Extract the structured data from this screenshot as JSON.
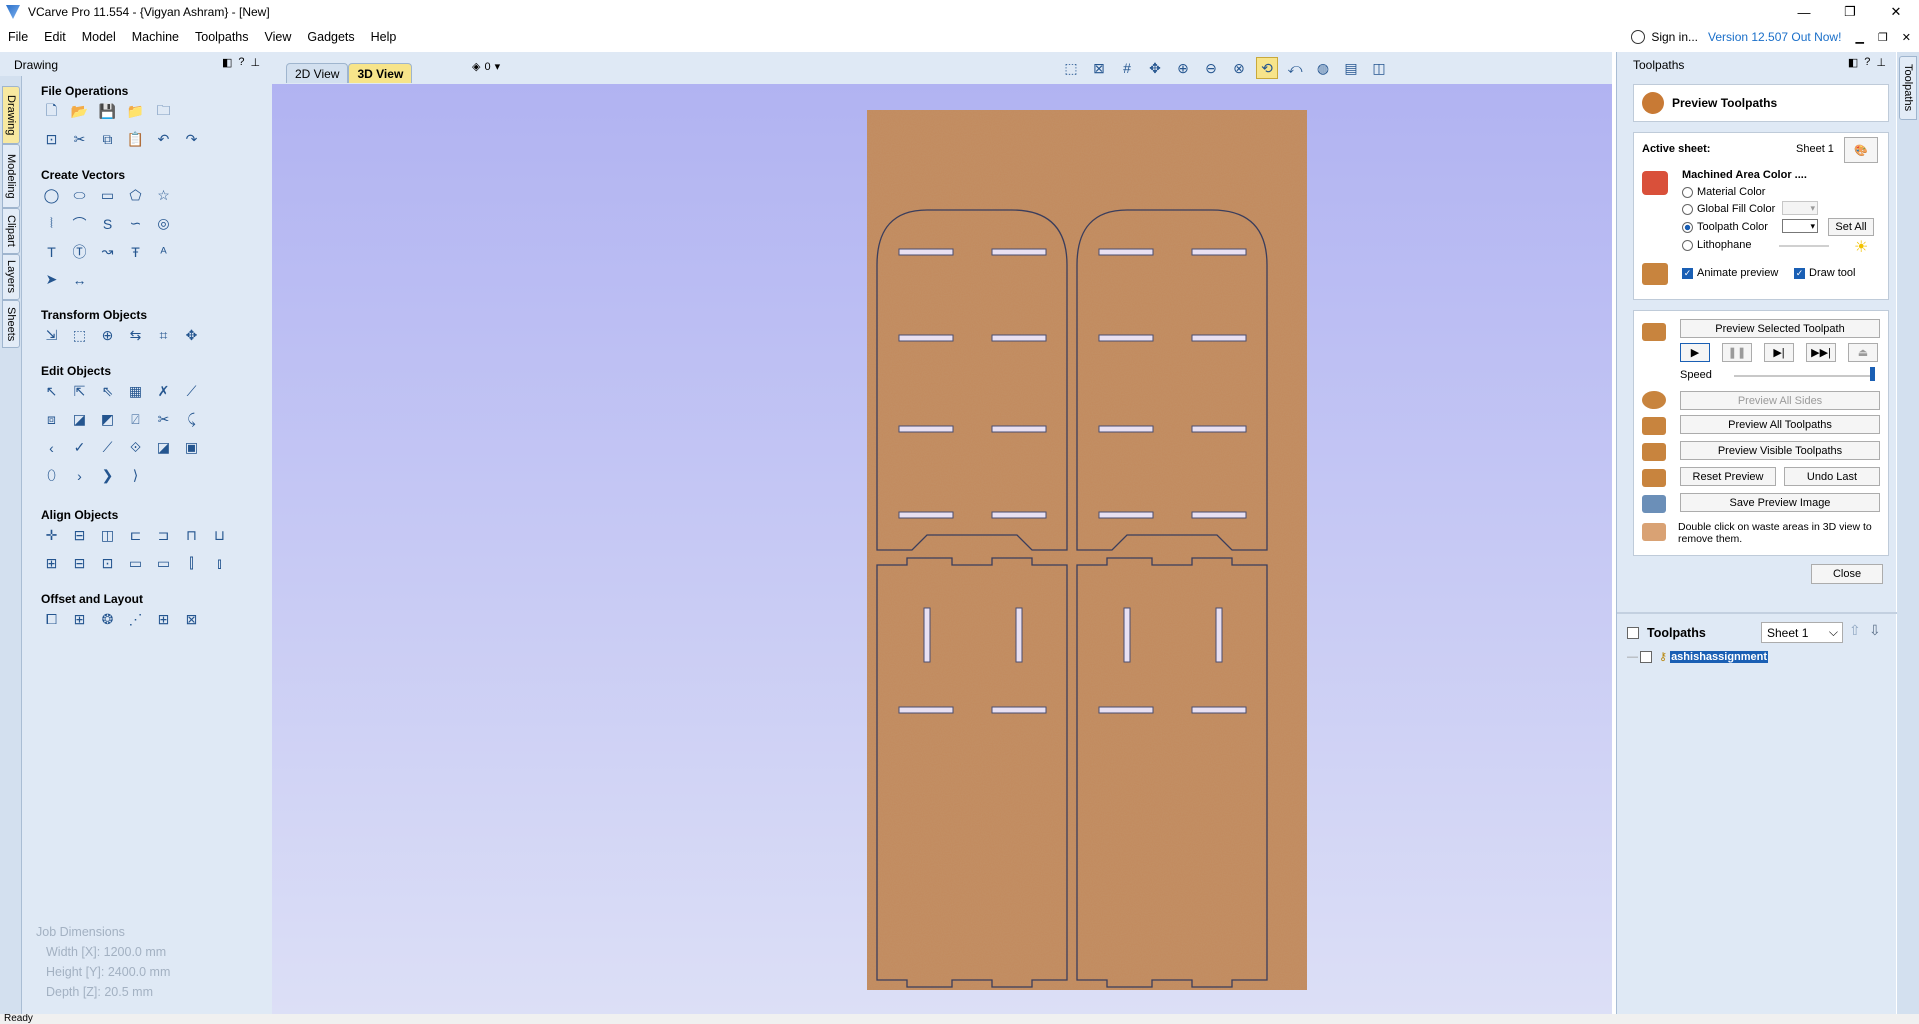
{
  "window": {
    "title": "VCarve Pro 11.554 - {Vigyan Ashram} - [New]",
    "buttons": [
      "—",
      "❐",
      "✕"
    ]
  },
  "menu": {
    "items": [
      "File",
      "Edit",
      "Model",
      "Machine",
      "Toolpaths",
      "View",
      "Gadgets",
      "Help"
    ],
    "sign_in": "Sign in...",
    "version": "Version 12.507 Out Now!"
  },
  "left_panel": {
    "title": "Drawing",
    "vertical_tabs": [
      "Drawing",
      "Modeling",
      "Clipart",
      "Layers",
      "Sheets"
    ],
    "sections": {
      "file_operations": "File Operations",
      "create_vectors": "Create Vectors",
      "transform_objects": "Transform Objects",
      "edit_objects": "Edit Objects",
      "align_objects": "Align Objects",
      "offset_layout": "Offset and Layout"
    },
    "job_dimensions": {
      "title": "Job Dimensions",
      "width": "Width  [X]: 1200.0 mm",
      "height": "Height [Y]: 2400.0 mm",
      "depth": "Depth  [Z]: 20.5 mm"
    }
  },
  "view": {
    "tab_2d": "2D View",
    "tab_3d": "3D View",
    "layer_value": "0"
  },
  "right_panel": {
    "title": "Toolpaths",
    "vertical_tab": "Toolpaths",
    "preview_title": "Preview Toolpaths",
    "active_sheet_label": "Active sheet:",
    "active_sheet_value": "Sheet 1",
    "machined_area_color": "Machined Area Color ....",
    "options": [
      "Material Color",
      "Global Fill Color",
      "Toolpath Color",
      "Lithophane"
    ],
    "set_all": "Set All",
    "animate_preview": "Animate preview",
    "draw_tool": "Draw tool",
    "preview_selected": "Preview Selected Toolpath",
    "speed": "Speed",
    "preview_all_sides": "Preview All Sides",
    "preview_all": "Preview All Toolpaths",
    "preview_visible": "Preview Visible Toolpaths",
    "reset_preview": "Reset Preview",
    "undo_last": "Undo Last",
    "save_preview_image": "Save Preview Image",
    "hint": "Double click on waste areas in 3D view to remove them.",
    "close": "Close",
    "toolpaths_label": "Toolpaths",
    "sheet_select": "Sheet 1",
    "toolpath_item": "ashishassignment"
  },
  "status": {
    "text": "Ready"
  }
}
